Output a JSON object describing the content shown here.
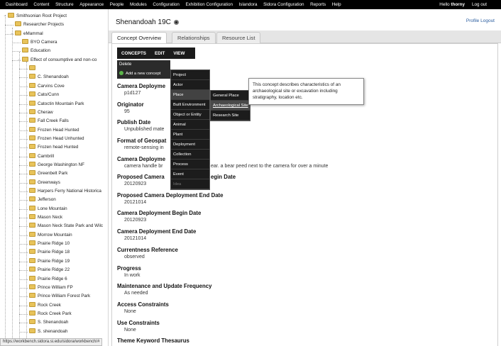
{
  "topbar": {
    "menu": [
      "Dashboard",
      "Content",
      "Structure",
      "Appearance",
      "People",
      "Modules",
      "Configuration",
      "Exhibition Configuration",
      "Islandora",
      "Sidora Configuration",
      "Reports",
      "Help"
    ],
    "greeting_prefix": "Hello",
    "username": "thorny",
    "logout": "Log out"
  },
  "tree": {
    "items": [
      {
        "label": "Smithsonian Root Project",
        "depth": 0
      },
      {
        "label": "Researcher Projects",
        "depth": 1
      },
      {
        "label": "eMammal",
        "depth": 1
      },
      {
        "label": "BYO Camera",
        "depth": 2
      },
      {
        "label": "Education",
        "depth": 2
      },
      {
        "label": "Effect of consumptive and non-co",
        "depth": 2
      },
      {
        "label": "",
        "depth": 3
      },
      {
        "label": "C. Shenandoah",
        "depth": 3
      },
      {
        "label": "Carvins Cove",
        "depth": 3
      },
      {
        "label": "Cato/Cunn",
        "depth": 3
      },
      {
        "label": "Catoctin Mountain Park",
        "depth": 3
      },
      {
        "label": "Cheraw",
        "depth": 3
      },
      {
        "label": "Fall Creek Falls",
        "depth": 3
      },
      {
        "label": "Frozen Head Hunted",
        "depth": 3
      },
      {
        "label": "Frozen Head Unhunted",
        "depth": 3
      },
      {
        "label": "Frozen head Hunted",
        "depth": 3
      },
      {
        "label": "Cambrill",
        "depth": 3
      },
      {
        "label": "George Washington NF",
        "depth": 3
      },
      {
        "label": "Greenbelt Park",
        "depth": 3
      },
      {
        "label": "Greenways",
        "depth": 3
      },
      {
        "label": "Harpers Ferry National Historica",
        "depth": 3
      },
      {
        "label": "Jefferson",
        "depth": 3
      },
      {
        "label": "Lone Mountain",
        "depth": 3
      },
      {
        "label": "Mason Neck",
        "depth": 3
      },
      {
        "label": "Mason Neck State Park and Wilc",
        "depth": 3
      },
      {
        "label": "Morrow Mountain",
        "depth": 3
      },
      {
        "label": "Prairie Ridge 10",
        "depth": 3
      },
      {
        "label": "Prairie Ridge 18",
        "depth": 3
      },
      {
        "label": "Prairie Ridge 19",
        "depth": 3
      },
      {
        "label": "Prairie Ridge 22",
        "depth": 3
      },
      {
        "label": "Prairie Ridge 6",
        "depth": 3
      },
      {
        "label": "Prince William FP",
        "depth": 3
      },
      {
        "label": "Prince William Forest Park",
        "depth": 3
      },
      {
        "label": "Rock Creek",
        "depth": 3
      },
      {
        "label": "Rock Creek Park",
        "depth": 3
      },
      {
        "label": "S. Shenandoah",
        "depth": 3
      },
      {
        "label": "S. shenandoah",
        "depth": 3
      }
    ]
  },
  "status_url": "https://workbench.sidora.si.edu/sidora/workbench/#",
  "main": {
    "title": "Shenandoah 19C",
    "profile_logout": "Profile Logout",
    "tabs": [
      "Concept Overview",
      "Relationships",
      "Resource List"
    ],
    "toolbar": [
      "CONCEPTS",
      "EDIT",
      "VIEW"
    ],
    "delete_label": "Delete",
    "add_new_label": "Add a new concept",
    "menu_level1": [
      "Project",
      "Actor",
      "Place",
      "Built Environment",
      "Object or Entity",
      "Animal",
      "Plant",
      "Deployment",
      "Collection",
      "Process",
      "Event",
      "Idea"
    ],
    "menu_level2": [
      "General Place",
      "Archaeological Site",
      "Research Site"
    ],
    "tooltip": "This concept describes characteristics of an archaeological site or excavation including stratigraphy, location etc.",
    "fields": [
      {
        "label": "Camera Deployme",
        "value": "p1d127"
      },
      {
        "label": "Originator",
        "value": "95"
      },
      {
        "label": "Publish Date",
        "value": "Unpublished mate"
      },
      {
        "label": "Format of Geospat",
        "value": "remote-sensing in"
      },
      {
        "label": "Camera Deployme",
        "value": "camera handle br"
      },
      {
        "label": "Proposed Camera",
        "value": "20120923"
      },
      {
        "label": "Proposed Camera Deployment End Date",
        "value": "20121014"
      },
      {
        "label": "Camera Deployment Begin Date",
        "value": "20120923"
      },
      {
        "label": "Camera Deployment End Date",
        "value": "20121014"
      },
      {
        "label": "Currentness Reference",
        "value": "observed"
      },
      {
        "label": "Progress",
        "value": "In work"
      },
      {
        "label": "Maintenance and Update Frequency",
        "value": "As needed"
      },
      {
        "label": "Access Constraints",
        "value": "None"
      },
      {
        "label": "Use Constraints",
        "value": "None"
      },
      {
        "label": "Theme Keyword Thesaurus",
        "value": ""
      }
    ],
    "overflow_notes": {
      "proposed_begin_suffix": "egin Date",
      "deployment_note_suffix": "ear. a bear peed next to the camera for over a minute"
    }
  }
}
